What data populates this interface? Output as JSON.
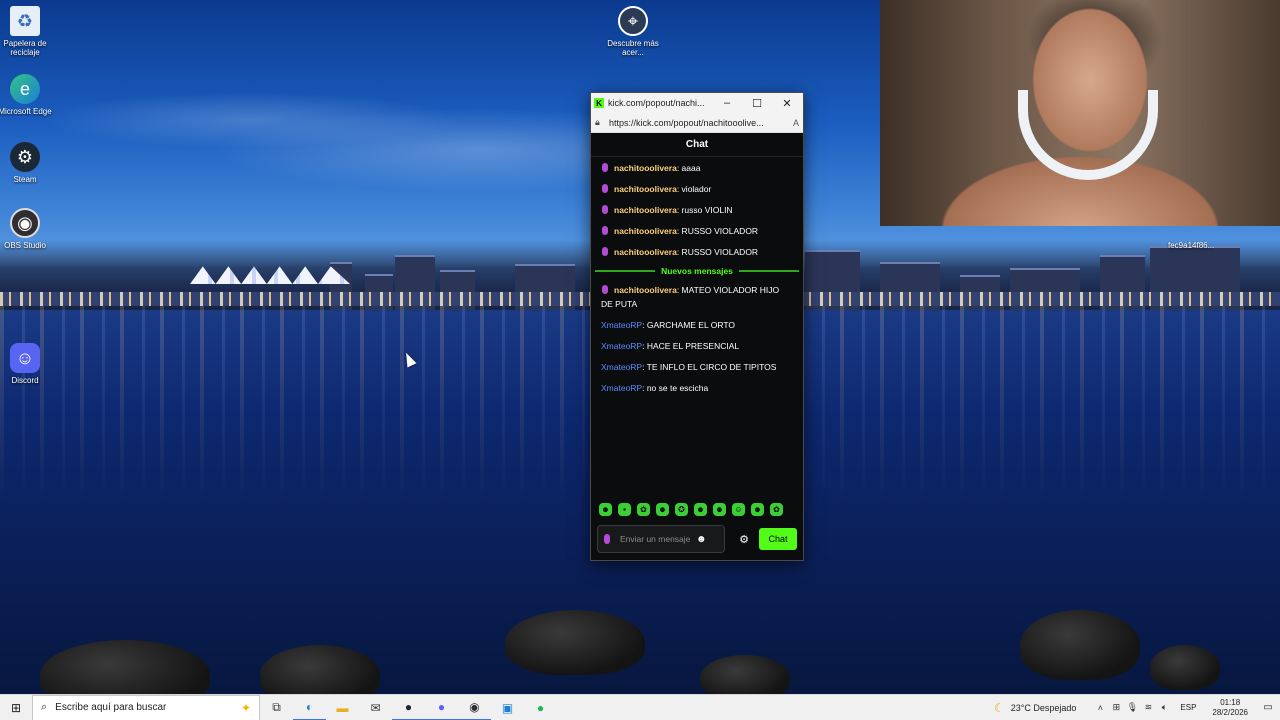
{
  "desktop": {
    "icons": [
      {
        "label": "Papelera de reciclaje",
        "icon": "recycle-bin-icon"
      },
      {
        "label": "Microsoft Edge",
        "icon": "edge-icon"
      },
      {
        "label": "Steam",
        "icon": "steam-icon"
      },
      {
        "label": "OBS Studio",
        "icon": "obs-icon"
      },
      {
        "label": "Discord",
        "icon": "discord-icon"
      },
      {
        "label": "Descubre más acer...",
        "icon": "discover-icon"
      }
    ]
  },
  "webcam": {
    "overlay_tag": "fec9a14f86..."
  },
  "popup": {
    "title": "kick.com/popout/nachi...",
    "url": "https://kick.com/popout/nachitooolive...",
    "chat_title": "Chat",
    "messages_before": [
      {
        "user": "nachitooolivera",
        "text": ": aaaa",
        "badge": true,
        "style": "n"
      },
      {
        "user": "nachitooolivera",
        "text": ": violador",
        "badge": true,
        "style": "n"
      },
      {
        "user": "nachitooolivera",
        "text": ": russo VIOLIN",
        "badge": true,
        "style": "n"
      },
      {
        "user": "nachitooolivera",
        "text": ": RUSSO VIOLADOR",
        "badge": true,
        "style": "n"
      },
      {
        "user": "nachitooolivera",
        "text": ": RUSSO VIOLADOR",
        "badge": true,
        "style": "n"
      }
    ],
    "new_messages_label": "Nuevos mensajes",
    "messages_after": [
      {
        "user": "nachitooolivera",
        "text": ": MATEO VIOLADOR HIJO DE PUTA",
        "badge": true,
        "style": "n"
      },
      {
        "user": "XmateoRP",
        "text": ": GARCHAME EL ORTO",
        "badge": false,
        "style": "x"
      },
      {
        "user": "XmateoRP",
        "text": ": HACE EL PRESENCIAL",
        "badge": false,
        "style": "x"
      },
      {
        "user": "XmateoRP",
        "text": ": TE INFLO EL CIRCO DE TIPITOS",
        "badge": false,
        "style": "x"
      },
      {
        "user": "XmateoRP",
        "text": ": no se te escicha",
        "badge": false,
        "style": "x"
      }
    ],
    "emotes": [
      "emote-1",
      "emote-2",
      "emote-3",
      "emote-4",
      "emote-5",
      "emote-6",
      "emote-7",
      "emote-8",
      "emote-9",
      "emote-10"
    ],
    "input_placeholder": "Enviar un mensaje",
    "send_label": "Chat"
  },
  "taskbar": {
    "search_placeholder": "Escribe aquí para buscar",
    "apps": [
      "task-view-icon",
      "edge-icon",
      "file-explorer-icon",
      "mail-icon",
      "steam-icon",
      "discord-icon",
      "obs-icon",
      "store-icon",
      "spotify-icon"
    ],
    "weather": "23°C  Despejado",
    "language": "ESP",
    "time": "01:18",
    "date": "28/2/2026"
  },
  "colors": {
    "kick_green": "#53fc18",
    "username_gold": "#ffd07a",
    "username_blue": "#5e8cff"
  }
}
